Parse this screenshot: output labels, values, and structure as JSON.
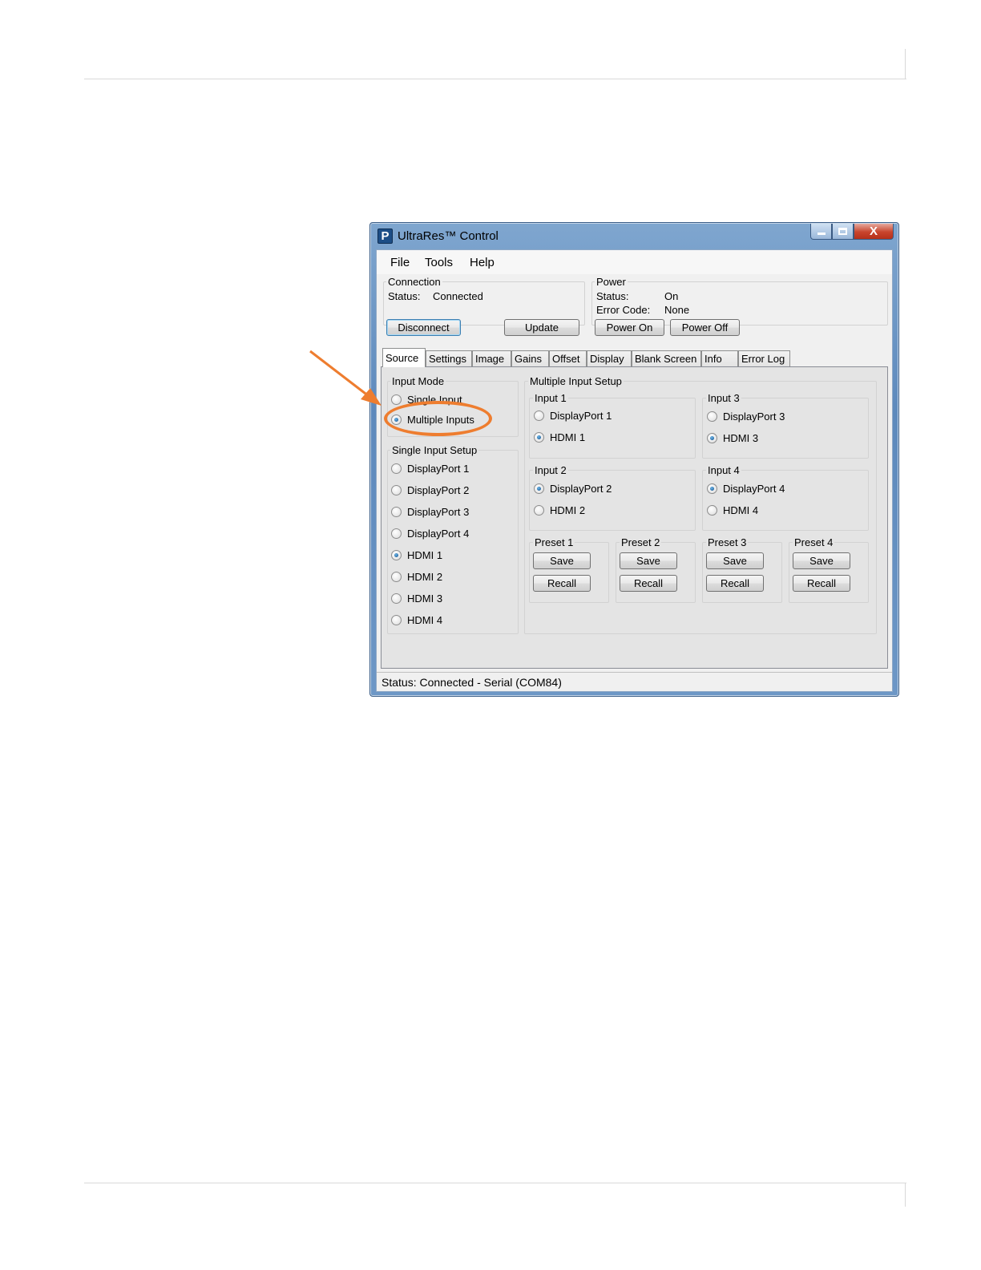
{
  "app": {
    "icon_letter": "P",
    "title": "UltraRes™ Control",
    "window_buttons": {
      "minimize_icon": "minimize-icon",
      "maximize_icon": "maximize-icon",
      "close_glyph": "X"
    }
  },
  "menu": [
    "File",
    "Tools",
    "Help"
  ],
  "connection": {
    "group": "Connection",
    "status_label": "Status:",
    "status_value": "Connected",
    "disconnect": "Disconnect",
    "update": "Update"
  },
  "power": {
    "group": "Power",
    "status_label": "Status:",
    "status_value": "On",
    "error_label": "Error Code:",
    "error_value": "None",
    "power_on": "Power On",
    "power_off": "Power Off"
  },
  "tabs": [
    "Source",
    "Settings",
    "Image",
    "Gains",
    "Offset",
    "Display",
    "Blank Screen",
    "Info",
    "Error Log"
  ],
  "active_tab": "Source",
  "input_mode": {
    "title": "Input Mode",
    "options": [
      {
        "label": "Single Input",
        "checked": false
      },
      {
        "label": "Multiple Inputs",
        "checked": true
      }
    ]
  },
  "single_input_setup": {
    "title": "Single Input Setup",
    "options": [
      {
        "label": "DisplayPort 1",
        "checked": false
      },
      {
        "label": "DisplayPort 2",
        "checked": false
      },
      {
        "label": "DisplayPort 3",
        "checked": false
      },
      {
        "label": "DisplayPort 4",
        "checked": false
      },
      {
        "label": "HDMI 1",
        "checked": true
      },
      {
        "label": "HDMI 2",
        "checked": false
      },
      {
        "label": "HDMI 3",
        "checked": false
      },
      {
        "label": "HDMI 4",
        "checked": false
      }
    ]
  },
  "multiple_input_setup": {
    "title": "Multiple Input Setup",
    "inputs": [
      {
        "title": "Input 1",
        "options": [
          {
            "label": "DisplayPort 1",
            "checked": false
          },
          {
            "label": "HDMI 1",
            "checked": true
          }
        ]
      },
      {
        "title": "Input 3",
        "options": [
          {
            "label": "DisplayPort 3",
            "checked": false
          },
          {
            "label": "HDMI 3",
            "checked": true
          }
        ]
      },
      {
        "title": "Input 2",
        "options": [
          {
            "label": "DisplayPort 2",
            "checked": true
          },
          {
            "label": "HDMI 2",
            "checked": false
          }
        ]
      },
      {
        "title": "Input 4",
        "options": [
          {
            "label": "DisplayPort 4",
            "checked": true
          },
          {
            "label": "HDMI 4",
            "checked": false
          }
        ]
      }
    ],
    "presets": [
      {
        "title": "Preset 1",
        "save": "Save",
        "recall": "Recall"
      },
      {
        "title": "Preset 2",
        "save": "Save",
        "recall": "Recall"
      },
      {
        "title": "Preset 3",
        "save": "Save",
        "recall": "Recall"
      },
      {
        "title": "Preset 4",
        "save": "Save",
        "recall": "Recall"
      }
    ]
  },
  "status_bar": "Status:  Connected - Serial (COM84)",
  "annotation": {
    "color": "#ee7d2f",
    "target": "Multiple Inputs"
  }
}
